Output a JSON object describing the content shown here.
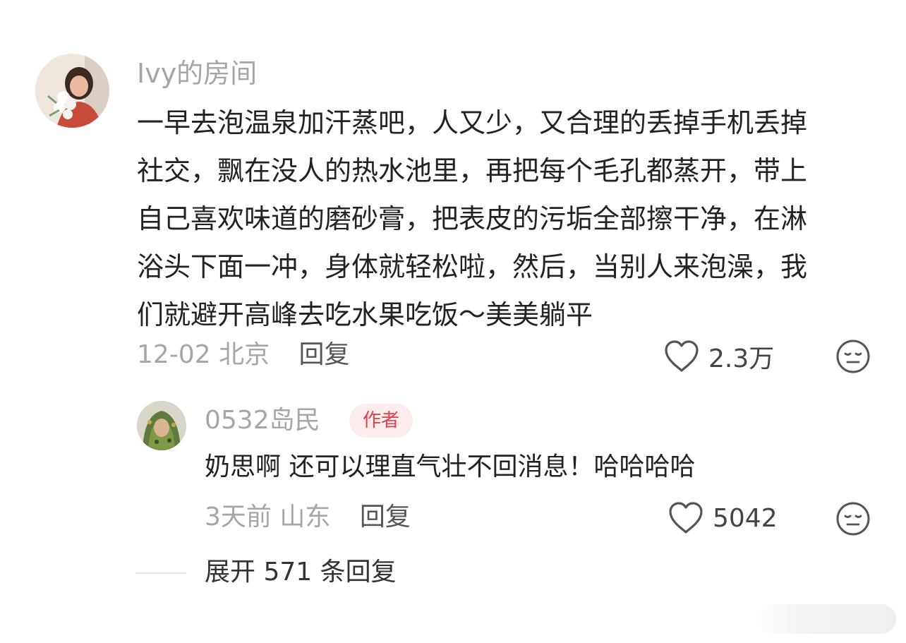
{
  "comment": {
    "author": "Ivy的房间",
    "text_lines": [
      "一早去泡温泉加汗蒸吧，人又少，又合理的丢掉手机丢掉",
      "社交，飘在没人的热水池里，再把每个毛孔都蒸开，带上",
      "自己喜欢味道的磨砂膏，把表皮的污垢全部擦干净，在淋",
      "浴头下面一冲，身体就轻松啦，然后，当别人来泡澡，我",
      "们就避开高峰去吃水果吃饭～美美躺平"
    ],
    "date": "12-02",
    "location": "北京",
    "reply_label": "回复",
    "like_count": "2.3万",
    "icons": {
      "like": "heart-icon",
      "dislike": "dislike-face-icon"
    }
  },
  "reply": {
    "author": "0532岛民",
    "badge": "作者",
    "text": "奶思啊 还可以理直气壮不回消息！哈哈哈哈",
    "date": "3天前",
    "location": "山东",
    "reply_label": "回复",
    "like_count": "5042",
    "icons": {
      "like": "heart-icon",
      "dislike": "dislike-face-icon"
    }
  },
  "expand": {
    "label": "展开 571 条回复"
  },
  "colors": {
    "muted_text": "#a6a6a6",
    "body_text": "#222222",
    "badge_bg": "#fdecec",
    "badge_text": "#e0404a"
  }
}
